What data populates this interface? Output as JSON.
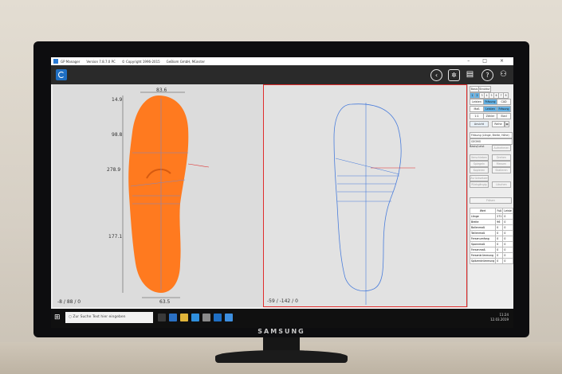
{
  "window": {
    "app_name": "GP Manager",
    "version": "Version 7.8.7.0 PC",
    "copyright": "© Copyright 1996-2015",
    "company": "GeBiom GmbH, Münster"
  },
  "toolbar": {
    "back_icon": "arrow-left-icon",
    "settings_icon": "gear-icon",
    "print_icon": "printer-icon",
    "help_label": "?",
    "user_icon": "user-icon"
  },
  "left_view": {
    "measurements": {
      "top_width": "83.6",
      "toe": "14.9",
      "ball_upper": "98.8",
      "ball": "278.9",
      "heel_length": "177.1",
      "heel_width": "63.5"
    },
    "coordinates": "-8 / 88 / 0",
    "fill_color": "#ff7a1f"
  },
  "right_view": {
    "coordinates": "-59 / -142 / 0",
    "border_color": "#e02c2c"
  },
  "sidebar": {
    "tabs": [
      "Basis",
      "Struktur"
    ],
    "steps": [
      "1",
      "2",
      "3",
      "4",
      "5",
      "6",
      "7",
      "8"
    ],
    "row1": [
      "Leisten",
      "Fräsung",
      "CAD"
    ],
    "row2": [
      "Maß",
      "Leisten",
      "Fräsung"
    ],
    "row3": [
      "1:1",
      "Zähler",
      "Eiad"
    ],
    "row4": [
      "Ansicht",
      "Reihe"
    ],
    "dropdown1": "Fräsung (Länge, Breite, Höhe)",
    "dropdown2": "GEOMO",
    "section_label": "Basis/Leist",
    "section_btn": "Aufnehmen",
    "grey_buttons": [
      "Verschieben",
      "Drehen",
      "Spiegeln",
      "Messen",
      "Kopieren",
      "Skalieren",
      "Zurücksetzen",
      "Rückgängig",
      "Löschen"
    ],
    "confirm_label": "Fräsen",
    "table": {
      "headers": [
        "Wert",
        "Fuß",
        "Leiste"
      ],
      "rows": [
        [
          "Länge",
          "271",
          "0"
        ],
        [
          "Breite",
          "96",
          "0"
        ],
        [
          "Ballenmaß",
          "0",
          "0"
        ],
        [
          "Taillenmaß",
          "0",
          "0"
        ],
        [
          "Fersenumfang",
          "0",
          "0"
        ],
        [
          "Spannmaß",
          "0",
          "0"
        ],
        [
          "Fersenmaß",
          "0",
          "0"
        ],
        [
          "Fersenkrümmung",
          "0",
          "0"
        ],
        [
          "Spitzenkrümmung",
          "0",
          "0"
        ]
      ]
    }
  },
  "taskbar": {
    "search_placeholder": "Zur Suche Text hier eingeben",
    "clock_time": "11:24",
    "clock_date": "12.03.2019"
  },
  "monitor": {
    "brand": "SAMSUNG"
  }
}
